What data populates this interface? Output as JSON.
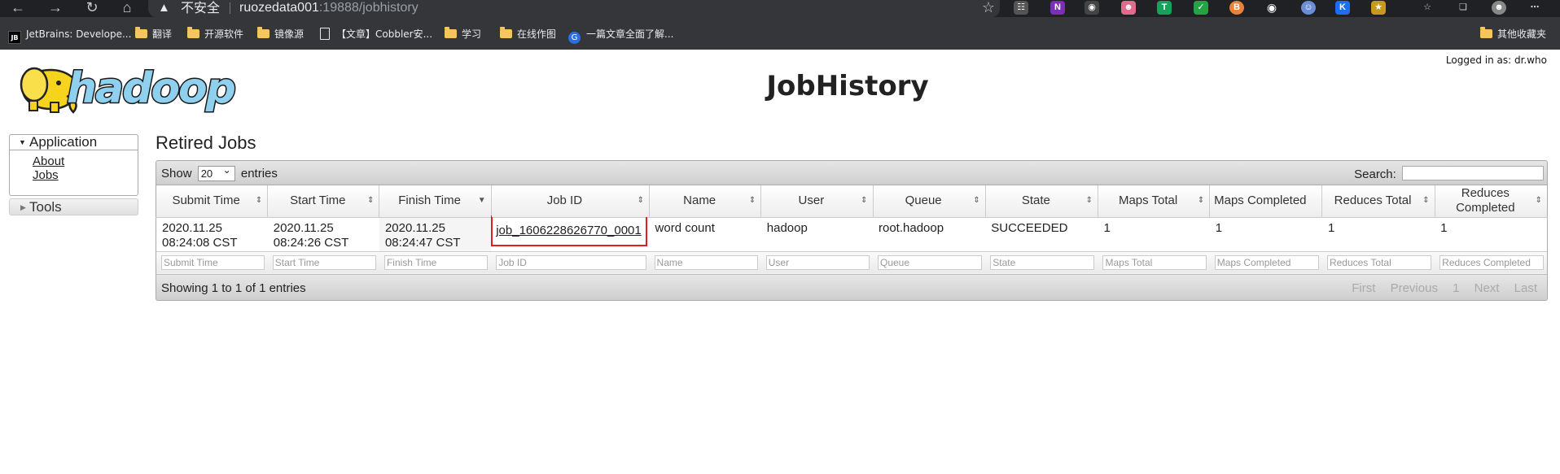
{
  "browser": {
    "security_warning": "不安全",
    "url_host": "ruozedata001",
    "url_rest": ":19888/jobhistory",
    "bookmarks": [
      {
        "label": "JetBrains: Develope...",
        "icon": "jetbrains-icon"
      },
      {
        "label": "翻译",
        "icon": "folder-icon"
      },
      {
        "label": "开源软件",
        "icon": "folder-icon"
      },
      {
        "label": "镜像源",
        "icon": "folder-icon"
      },
      {
        "label": "【文章】Cobbler安...",
        "icon": "page-icon"
      },
      {
        "label": "学习",
        "icon": "folder-icon"
      },
      {
        "label": "在线作图",
        "icon": "folder-icon"
      },
      {
        "label": "一篇文章全面了解...",
        "icon": "globe-icon"
      }
    ],
    "other_bookmarks": "其他收藏夹"
  },
  "page": {
    "title": "JobHistory",
    "logged_in": "Logged in as: dr.who",
    "logo_text": "hadoop"
  },
  "nav": {
    "application": "Application",
    "about": "About",
    "jobs": "Jobs",
    "tools": "Tools"
  },
  "section_title": "Retired Jobs",
  "table": {
    "show": "Show",
    "page_length": "20",
    "entries": "entries",
    "search_label": "Search:",
    "columns": [
      "Submit Time",
      "Start Time",
      "Finish Time",
      "Job ID",
      "Name",
      "User",
      "Queue",
      "State",
      "Maps Total",
      "Maps Completed",
      "Reduces Total",
      "Reduces Completed"
    ],
    "rows": [
      {
        "submit_time": "2020.11.25 08:24:08 CST",
        "start_time": "2020.11.25 08:24:26 CST",
        "finish_time": "2020.11.25 08:24:47 CST",
        "job_id": "job_1606228626770_0001",
        "name": "word count",
        "user": "hadoop",
        "queue": "root.hadoop",
        "state": "SUCCEEDED",
        "maps_total": "1",
        "maps_completed": "1",
        "reduces_total": "1",
        "reduces_completed": "1"
      }
    ],
    "filters": [
      "Submit Time",
      "Start Time",
      "Finish Time",
      "Job ID",
      "Name",
      "User",
      "Queue",
      "State",
      "Maps Total",
      "Maps Completed",
      "Reduces Total",
      "Reduces Completed"
    ],
    "info": "Showing 1 to 1 of 1 entries",
    "pager": {
      "first": "First",
      "previous": "Previous",
      "page": "1",
      "next": "Next",
      "last": "Last"
    }
  }
}
